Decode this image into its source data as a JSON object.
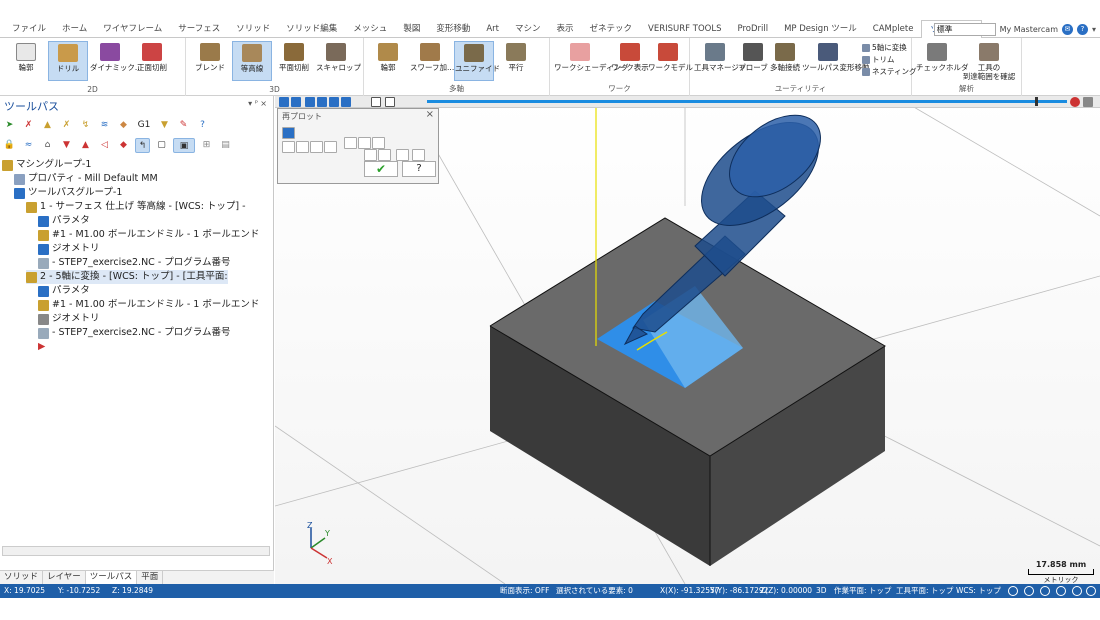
{
  "menu": {
    "tabs": [
      "ファイル",
      "ホーム",
      "ワイヤフレーム",
      "サーフェス",
      "ソリッド",
      "ソリッド編集",
      "メッシュ",
      "製図",
      "変形移動",
      "Art",
      "マシン",
      "表示",
      "ゼネテック",
      "VERISURF TOOLS",
      "ProDrill",
      "MP Design ツール",
      "CAMplete",
      "ツールパス"
    ],
    "active_tab": "ツールパス",
    "style_value": "標準",
    "user_label": "My Mastercam"
  },
  "ribbon": {
    "groups": {
      "g2d": "2D",
      "g3d": "3D",
      "multi": "多軸",
      "work": "ワーク",
      "util": "ユーティリティ",
      "analysis": "解析"
    },
    "buttons": {
      "contour": "輪郭",
      "drill": "ドリル",
      "dynamic": "ダイナミック...",
      "face": "正面切削",
      "blend": "ブレンド",
      "waterline": "等高線",
      "flat": "平面切削",
      "scallop": "スキャロップ",
      "multi_contour": "輪郭",
      "swarf": "スワーフ加...",
      "unified": "ユニファイド",
      "parallel": "平行",
      "stock_shading": "ワークシェーディング",
      "stock_display": "ワーク表示",
      "stock_model": "ワークモデル",
      "tool_manager": "工具マネージャ",
      "probe": "プローブ",
      "multi_linking": "多軸接続",
      "toolpath_transform": "ツールパス変形移動",
      "convert_5axis": "5軸に変換",
      "trim": "トリム",
      "nesting": "ネスティング",
      "check_holder": "チェックホルダ",
      "check_reach_line1": "工具の",
      "check_reach_line2": "到達範囲を確認"
    }
  },
  "left_panel": {
    "title": "ツールパス",
    "controls": "▾ ᴾ ×",
    "toolbar_labels": {
      "g1": "G1"
    },
    "tree": [
      {
        "text": "マシングループ-1"
      },
      {
        "text": "プロパティ - Mill Default MM"
      },
      {
        "text": "ツールパスグループ-1"
      },
      {
        "text": "1 - サーフェス 仕上げ 等高線 - [WCS: トップ] -"
      },
      {
        "text": "パラメタ"
      },
      {
        "text": "#1 - M1.00 ボールエンドミル - 1 ボールエンド"
      },
      {
        "text": "ジオメトリ"
      },
      {
        "text": "- STEP7_exercise2.NC - プログラム番号"
      },
      {
        "text": "2 - 5軸に変換 - [WCS: トップ] - [工具平面:"
      },
      {
        "text": "パラメタ"
      },
      {
        "text": "#1 - M1.00 ボールエンドミル - 1 ボールエンド"
      },
      {
        "text": "ジオメトリ"
      },
      {
        "text": "- STEP7_exercise2.NC - プログラム番号"
      }
    ],
    "bottom_tabs": [
      "ソリッド",
      "レイヤー",
      "ツールパス",
      "平面"
    ],
    "active_bottom_tab": "ツールパス"
  },
  "backplot": {
    "title": "再プロット",
    "progress": 0.95
  },
  "viewport": {
    "axis_labels": {
      "x": "X",
      "y": "Y",
      "z": "Z"
    },
    "scale_value": "17.858 mm",
    "scale_unit": "メトリック",
    "colors": {
      "block": "#5a5a5a",
      "pocket": "#2f8ee8",
      "tool": "#1d4c8c",
      "spindle_line": "#e8e000"
    }
  },
  "status": {
    "coord_x": "X: 19.7025",
    "coord_y": "Y: -10.7252",
    "coord_z": "Z: 19.2849",
    "section_view": "断面表示: OFF",
    "selected": "選択されている要素: 0",
    "x_val": "X(X):  -91.32557",
    "y_val": "Y(Y):  -86.17292",
    "z_val": "Z(Z):  0.00000",
    "mode": "3D",
    "cplane": "作業平面: トップ",
    "tplane": "工具平面: トップ",
    "wcs": "WCS: トップ"
  }
}
